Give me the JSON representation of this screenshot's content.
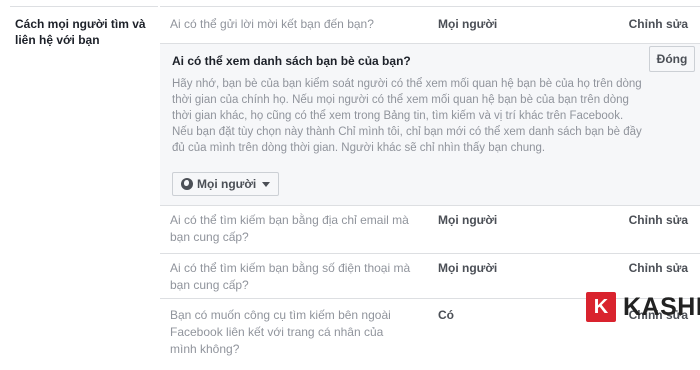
{
  "section": {
    "label": "Cách mọi người tìm và liên hệ với bạn"
  },
  "rows": [
    {
      "question": "Ai có thể gửi lời mời kết bạn đến bạn?",
      "value": "Mọi người",
      "edit": "Chỉnh sửa"
    },
    {
      "question": "Ai có thể tìm kiếm bạn bằng địa chỉ email mà bạn cung cấp?",
      "value": "Mọi người",
      "edit": "Chỉnh sửa"
    },
    {
      "question": "Ai có thể tìm kiếm bạn bằng số điện thoại mà bạn cung cấp?",
      "value": "Mọi người",
      "edit": "Chỉnh sửa"
    },
    {
      "question": "Bạn có muốn công cụ tìm kiếm bên ngoài Facebook liên kết với trang cá nhân của mình không?",
      "value": "Có",
      "edit": "Chỉnh sửa"
    }
  ],
  "expanded": {
    "title": "Ai có thể xem danh sách bạn bè của bạn?",
    "close_label": "Đóng",
    "description": "Hãy nhớ, bạn bè của bạn kiểm soát người có thể xem mối quan hệ bạn bè của họ trên dòng thời gian của chính họ. Nếu mọi người có thể xem mối quan hệ bạn bè của bạn trên dòng thời gian khác, họ cũng có thể xem trong Bảng tin, tìm kiếm và vị trí khác trên Facebook. Nếu bạn đặt tùy chọn này thành Chỉ mình tôi, chỉ bạn mới có thể xem danh sách bạn bè đầy đủ của mình trên dòng thời gian. Người khác sẽ chỉ nhìn thấy bạn chung.",
    "audience_label": "Mọi người"
  },
  "watermark": {
    "letter": "K",
    "text": "KASHI"
  },
  "icons": {
    "audience": "globe-icon",
    "dropdown": "caret-down-icon"
  },
  "colors": {
    "expanded_bg": "#f6f7f9",
    "divider": "#dddfe2",
    "logo_red": "#d9232e"
  }
}
